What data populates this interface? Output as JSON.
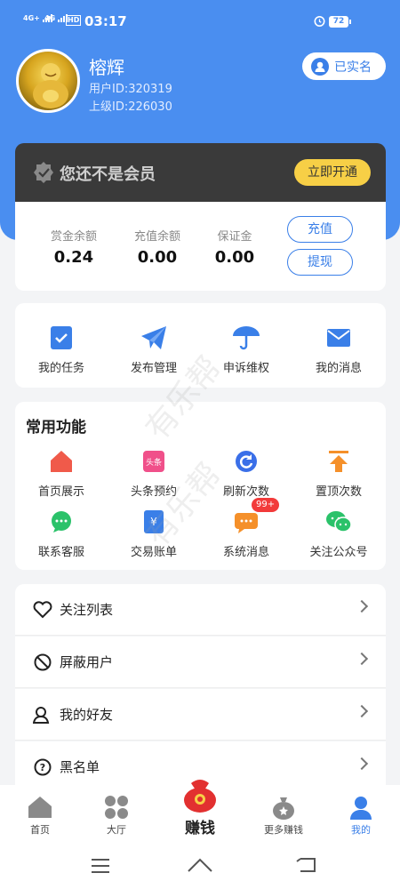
{
  "status": {
    "sig1": "4G+",
    "sig2": "4G",
    "hd": "HD",
    "time": "03:17",
    "battery": "72"
  },
  "profile": {
    "name": "榕辉",
    "uid": "用户ID:320319",
    "parent": "上级ID:226030",
    "verified": "已实名"
  },
  "vip": {
    "text": "您还不是会员",
    "button": "立即开通"
  },
  "balance": {
    "items": [
      {
        "label": "赏金余额",
        "value": "0.24"
      },
      {
        "label": "充值余额",
        "value": "0.00"
      },
      {
        "label": "保证金",
        "value": "0.00"
      }
    ],
    "recharge": "充值",
    "withdraw": "提现"
  },
  "quick": [
    {
      "label": "我的任务",
      "icon": "task-icon"
    },
    {
      "label": "发布管理",
      "icon": "paper-plane-icon"
    },
    {
      "label": "申诉维权",
      "icon": "umbrella-icon"
    },
    {
      "label": "我的消息",
      "icon": "mail-icon"
    }
  ],
  "common": {
    "title": "常用功能",
    "items": [
      {
        "label": "首页展示",
        "icon": "home-icon"
      },
      {
        "label": "头条预约",
        "icon": "headline-icon",
        "badge_text": "头条"
      },
      {
        "label": "刷新次数",
        "icon": "refresh-icon"
      },
      {
        "label": "置顶次数",
        "icon": "pin-top-icon"
      },
      {
        "label": "联系客服",
        "icon": "chat-icon"
      },
      {
        "label": "交易账单",
        "icon": "bill-icon"
      },
      {
        "label": "系统消息",
        "icon": "message-icon",
        "badge": "99+"
      },
      {
        "label": "关注公众号",
        "icon": "wechat-icon"
      }
    ]
  },
  "list": [
    {
      "label": "关注列表",
      "icon": "heart-icon"
    },
    {
      "label": "屏蔽用户",
      "icon": "block-icon"
    },
    {
      "label": "我的好友",
      "icon": "friends-icon"
    },
    {
      "label": "黑名单",
      "icon": "question-icon"
    }
  ],
  "tabs": [
    {
      "label": "首页",
      "icon": "home-tab-icon"
    },
    {
      "label": "大厅",
      "icon": "grid-icon"
    },
    {
      "label": "赚钱",
      "icon": "money-bag-icon"
    },
    {
      "label": "更多赚钱",
      "icon": "bag-icon"
    },
    {
      "label": "我的",
      "icon": "person-icon",
      "active": true
    }
  ],
  "watermark": "有乐帮",
  "colors": {
    "primary": "#4a8ef0",
    "vip_gold": "#f7cf46",
    "active_tab": "#3a7fe8"
  }
}
